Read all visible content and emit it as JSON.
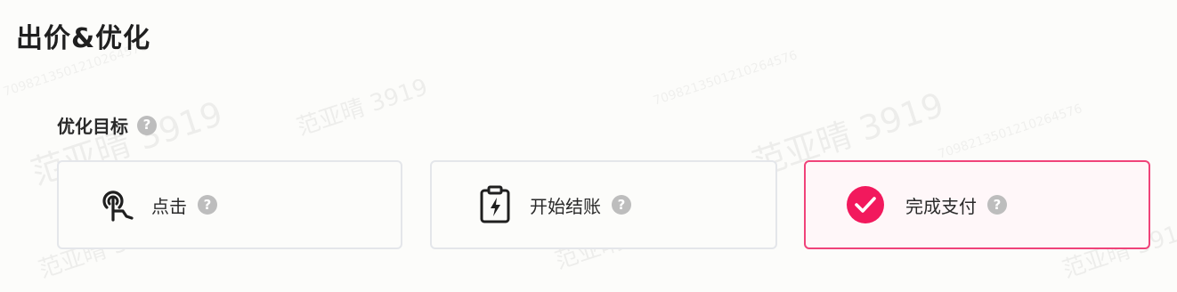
{
  "section": {
    "title": "出价&优化"
  },
  "optimization_goal": {
    "label": "优化目标",
    "help": "?",
    "options": [
      {
        "label": "点击",
        "icon": "tap-icon",
        "selected": false,
        "help": "?"
      },
      {
        "label": "开始结账",
        "icon": "clipboard-bolt-icon",
        "selected": false,
        "help": "?"
      },
      {
        "label": "完成支付",
        "icon": "check-circle-icon",
        "selected": true,
        "help": "?"
      }
    ]
  },
  "watermark": {
    "name": "范亚晴 3919",
    "code": "7098213501210264576"
  },
  "colors": {
    "accent": "#f0437a",
    "check": "#f2195d",
    "help": "#bdbdbd",
    "border": "#e4e6ea"
  }
}
